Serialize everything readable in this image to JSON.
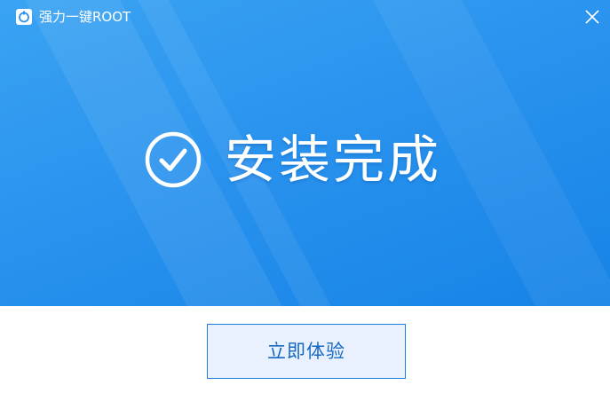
{
  "window": {
    "title": "强力一键ROOT"
  },
  "status": {
    "message": "安装完成"
  },
  "actions": {
    "primary_label": "立即体验"
  },
  "icons": {
    "app": "app-logo-icon",
    "close": "close-icon",
    "status": "check-circle-icon"
  },
  "colors": {
    "banner_top": "#3aa3f2",
    "banner_bottom": "#1683e6",
    "button_border": "#1f7fe0",
    "button_fill": "#e8f1fd",
    "button_text": "#1768c4"
  }
}
